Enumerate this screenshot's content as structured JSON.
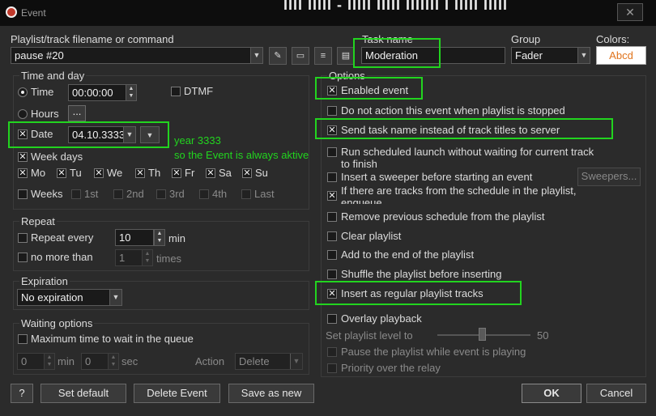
{
  "window": {
    "title": "Event",
    "bg_text": "IIII IIIII - IIIII IIIII IIIIIII I IIIII IIIII",
    "close": "✕"
  },
  "top": {
    "filename_label": "Playlist/track filename or command",
    "filename_value": "pause #20",
    "task_label": "Task name",
    "task_value": "Moderation",
    "group_label": "Group",
    "group_value": "Fader",
    "colors_label": "Colors:",
    "colors_sample": "Abcd",
    "colors_sample_color": "#e0731c"
  },
  "time_and_day": {
    "heading": "Time and day",
    "time_label": "Time",
    "time_value": "00:00:00",
    "dtmf_label": "DTMF",
    "hours_label": "Hours",
    "hours_button": "...",
    "date_label": "Date",
    "date_value": "04.10.3333",
    "weekdays_label": "Week days",
    "days": [
      "Mo",
      "Tu",
      "We",
      "Th",
      "Fr",
      "Sa",
      "Su"
    ],
    "weeks_label": "Weeks",
    "weeks": [
      "1st",
      "2nd",
      "3rd",
      "4th",
      "Last"
    ]
  },
  "repeat": {
    "heading": "Repeat",
    "every_label": "Repeat every",
    "every_value": "10",
    "every_unit": "min",
    "nomore_label": "no more than",
    "nomore_value": "1",
    "nomore_unit": "times"
  },
  "expiration": {
    "heading": "Expiration",
    "value": "No expiration"
  },
  "waiting": {
    "heading": "Waiting options",
    "max_label": "Maximum time to wait in the queue",
    "min_value": "0",
    "min_unit": "min",
    "sec_value": "0",
    "sec_unit": "sec",
    "action_label": "Action",
    "action_value": "Delete"
  },
  "options": {
    "heading": "Options",
    "items": [
      "Enabled event",
      "Do not action this event when playlist is stopped",
      "Send task name instead of track titles to server",
      "Run scheduled launch without waiting for current track",
      "to finish",
      "Insert a sweeper before starting an event",
      "If there are tracks from the schedule in the playlist,",
      "enqueue",
      "Remove previous schedule from the playlist",
      "Clear playlist",
      "Add to the end of the playlist",
      "Shuffle the playlist before inserting",
      "Insert as regular playlist tracks",
      "Overlay playback",
      "Pause the playlist while event is playing",
      "Priority over the relay"
    ],
    "sweepers_button": "Sweepers...",
    "level_label": "Set playlist level to",
    "level_value": "50"
  },
  "annotations": {
    "line1": "year 3333",
    "line2": "so the Event is always aktive"
  },
  "buttons": {
    "help": "?",
    "set_default": "Set default",
    "delete_event": "Delete Event",
    "save_as_new": "Save as new",
    "ok": "OK",
    "cancel": "Cancel"
  },
  "icons": [
    "pin-icon",
    "folder-icon",
    "list-icon",
    "message-icon"
  ]
}
